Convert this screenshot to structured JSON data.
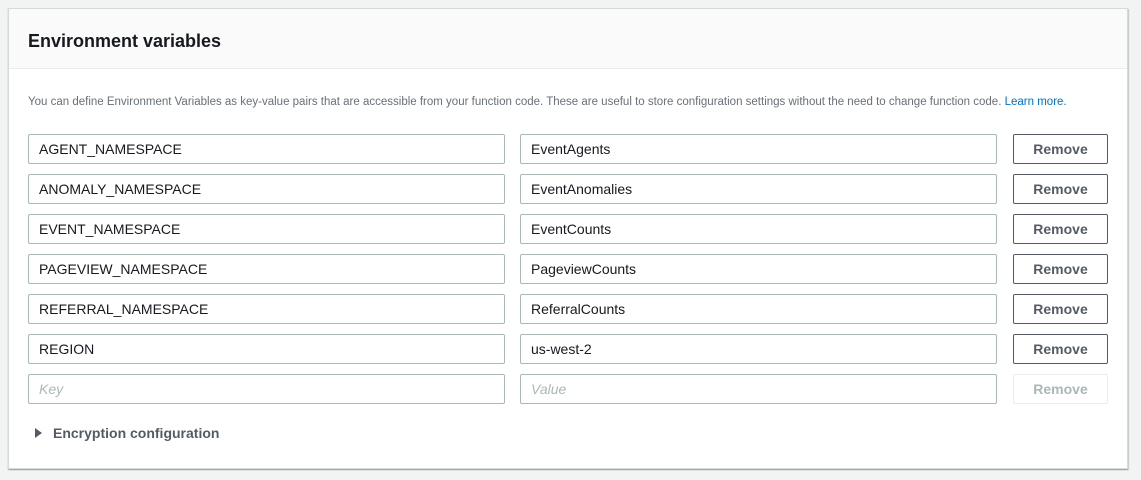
{
  "panel": {
    "title": "Environment variables",
    "description": "You can define Environment Variables as key-value pairs that are accessible from your function code. These are useful to store configuration settings without the need to change function code.",
    "learn_more": "Learn more."
  },
  "variables": [
    {
      "key": "AGENT_NAMESPACE",
      "value": "EventAgents",
      "remove_label": "Remove"
    },
    {
      "key": "ANOMALY_NAMESPACE",
      "value": "EventAnomalies",
      "remove_label": "Remove"
    },
    {
      "key": "EVENT_NAMESPACE",
      "value": "EventCounts",
      "remove_label": "Remove"
    },
    {
      "key": "PAGEVIEW_NAMESPACE",
      "value": "PageviewCounts",
      "remove_label": "Remove"
    },
    {
      "key": "REFERRAL_NAMESPACE",
      "value": "ReferralCounts",
      "remove_label": "Remove"
    },
    {
      "key": "REGION",
      "value": "us-west-2",
      "remove_label": "Remove"
    }
  ],
  "new_variable": {
    "key_placeholder": "Key",
    "value_placeholder": "Value",
    "remove_label": "Remove"
  },
  "encryption": {
    "label": "Encryption configuration"
  },
  "colors": {
    "link": "#0073bb",
    "border": "#aab7b8",
    "button_text": "#545b64"
  }
}
